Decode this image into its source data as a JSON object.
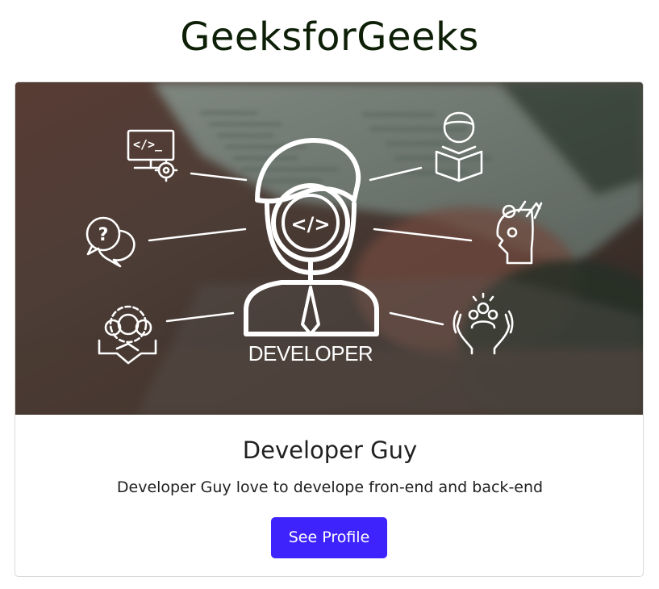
{
  "header": {
    "title": "GeeksforGeeks"
  },
  "card": {
    "image": {
      "caption": "DEVELOPER",
      "code_glyph": "</>",
      "monitor_glyph": "</>_",
      "help_glyph": "?"
    },
    "title": "Developer Guy",
    "text": "Developer Guy love to develope fron-end and back-end",
    "button_label": "See Profile"
  },
  "colors": {
    "title_text": "#0d1f06",
    "body_text": "#212121",
    "button_bg": "#3e23fc",
    "button_text": "#ffffff",
    "card_border": "#d9d9d9"
  }
}
